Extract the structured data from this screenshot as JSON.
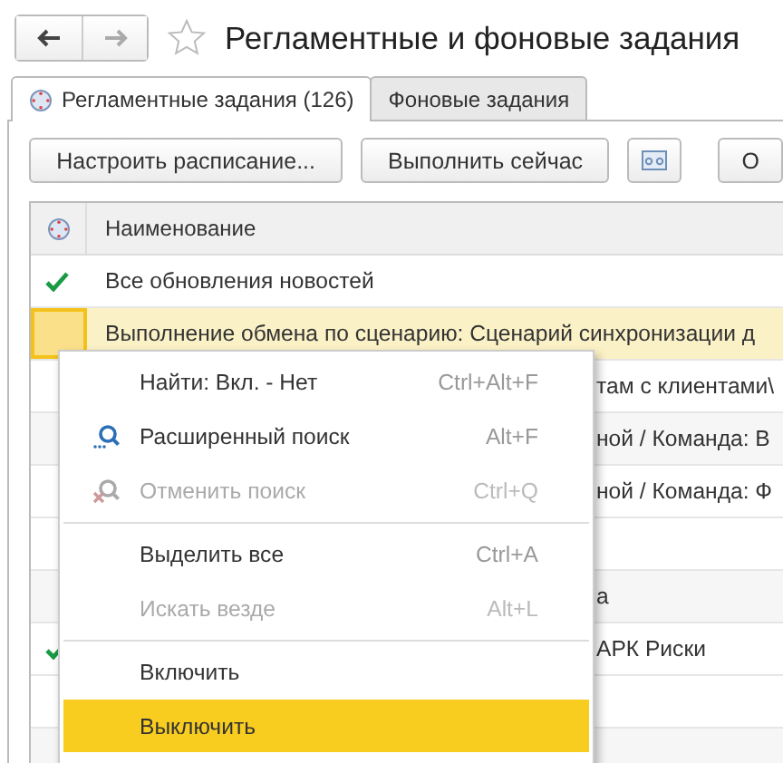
{
  "title": "Регламентные и фоновые задания",
  "tabs": [
    {
      "label": "Регламентные задания (126)",
      "selected": true
    },
    {
      "label": "Фоновые задания",
      "selected": false
    }
  ],
  "toolbar": [
    {
      "kind": "text",
      "label": "Настроить расписание..."
    },
    {
      "kind": "text",
      "label": "Выполнить сейчас"
    },
    {
      "kind": "icon"
    },
    {
      "kind": "text",
      "label": "О"
    }
  ],
  "table": {
    "columns": [
      "Наименование"
    ],
    "rows": [
      {
        "name": "Все обновления новостей",
        "enabled": true,
        "selected": false,
        "partial": false
      },
      {
        "name": "Выполнение обмена по сценарию: Сценарий синхронизации д",
        "enabled": false,
        "selected": true,
        "partial": false
      },
      {
        "name": "там с клиентами\\",
        "enabled": false,
        "selected": false,
        "partial": true
      },
      {
        "name": "ной / Команда: В",
        "enabled": false,
        "selected": false,
        "partial": true
      },
      {
        "name": "ной / Команда: Ф",
        "enabled": false,
        "selected": false,
        "partial": true
      },
      {
        "enabled": false,
        "selected": false
      },
      {
        "name": "а",
        "enabled": false,
        "selected": false,
        "partial": true
      },
      {
        "name": "АРК Риски",
        "enabled": true,
        "selected": false,
        "partial": true
      }
    ]
  },
  "context_menu": {
    "items": [
      {
        "kind": "item",
        "label": "Найти: Вкл. - Нет",
        "shortcut": "Ctrl+Alt+F",
        "disabled": false,
        "selected": false
      },
      {
        "kind": "search",
        "label": "Расширенный поиск",
        "shortcut": "Alt+F",
        "disabled": false,
        "selected": false
      },
      {
        "kind": "cancel",
        "label": "Отменить поиск",
        "shortcut": "Ctrl+Q",
        "disabled": true,
        "selected": false
      },
      {
        "kind": "separator"
      },
      {
        "kind": "item",
        "label": "Выделить все",
        "shortcut": "Ctrl+A",
        "disabled": false,
        "selected": false
      },
      {
        "kind": "item",
        "label": "Искать везде",
        "shortcut": "Alt+L",
        "disabled": true,
        "selected": false
      },
      {
        "kind": "separator"
      },
      {
        "kind": "item",
        "label": "Включить",
        "disabled": false,
        "selected": false
      },
      {
        "kind": "item",
        "label": "Выключить",
        "disabled": false,
        "selected": true
      }
    ]
  }
}
